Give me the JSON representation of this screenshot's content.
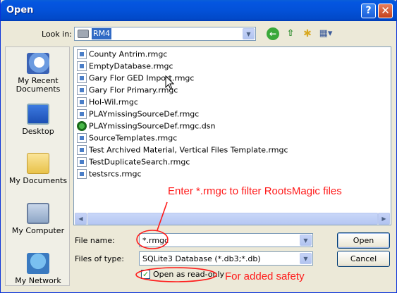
{
  "window": {
    "title": "Open",
    "help": "?",
    "close": "✕"
  },
  "lookin": {
    "label": "Look in:",
    "value": "RM4"
  },
  "places": [
    {
      "label": "My Recent Documents",
      "icon": "recent-documents-icon"
    },
    {
      "label": "Desktop",
      "icon": "desktop-icon"
    },
    {
      "label": "My Documents",
      "icon": "my-documents-icon"
    },
    {
      "label": "My Computer",
      "icon": "my-computer-icon"
    },
    {
      "label": "My Network",
      "icon": "my-network-icon"
    }
  ],
  "files": [
    "County Antrim.rmgc",
    "EmptyDatabase.rmgc",
    "Gary Flor GED Import.rmgc",
    "Gary Flor Primary.rmgc",
    "Hol-Wil.rmgc",
    "PLAYmissingSourceDef.rmgc",
    "PLAYmissingSourceDef.rmgc.dsn",
    "SourceTemplates.rmgc",
    "Test Archived Material, Vertical Files Template.rmgc",
    "TestDuplicateSearch.rmgc",
    "testsrcs.rmgc"
  ],
  "filename": {
    "label": "File name:",
    "value": "*.rmgc"
  },
  "filetype": {
    "label": "Files of type:",
    "value": "SQLite3 Database (*.db3;*.db)"
  },
  "readonly": {
    "label": "Open as read-only",
    "checked": true
  },
  "buttons": {
    "open": "Open",
    "cancel": "Cancel"
  },
  "annotations": {
    "filter_note": "Enter *.rmgc to filter RootsMagic files",
    "safety_note": "For added safety",
    "color": "#ff1a1a"
  }
}
